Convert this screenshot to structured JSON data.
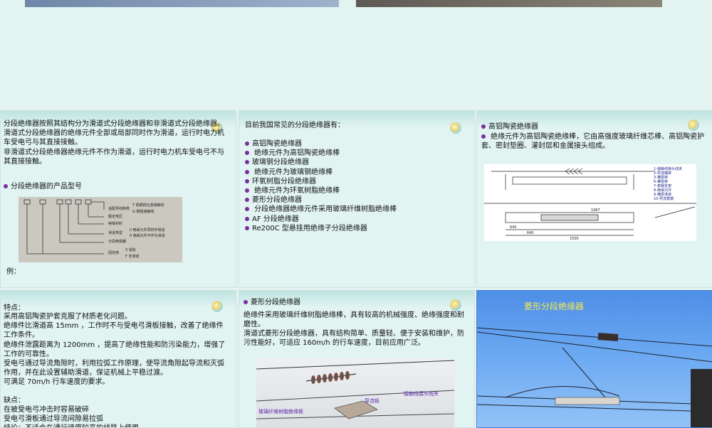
{
  "slide1": {
    "intro": "分段绝缘器按照其结构分为滑道式分段绝缘器和非滑道式分段绝缘器。\n滑道式分段绝缘器的绝缘元件全部或局部同时作为滑道，运行时电力机车受电弓与其直接接触。\n非滑道式分段绝缘器绝缘元件不作为滑道，运行时电力机车受电弓不与其直接接触。",
    "bullet": "分段绝缘器的产品型号",
    "example": "例："
  },
  "model_diagram": {
    "rows": [
      "适配导线种类",
      "额定电压",
      "绝缘材料",
      "滑道类型",
      "分段绝缘器",
      "固定用"
    ],
    "notes": [
      "T 铜或铜合金接触线",
      "G 钢铝接触线",
      "II 绝缘元件同时作滑道",
      "0 绝缘元件不作为滑道",
      "X 铝轨",
      "F 非滑道"
    ]
  },
  "slide2": {
    "title": "目前我国常见的分段绝缘器有：",
    "items": [
      "高铝陶瓷绝缘器",
      " 绝缘元件为高铝陶瓷绝缘棒",
      "玻璃钢分段绝缘器",
      " 绝缘元件为玻璃钢绝缘棒",
      "环氧树脂分段绝缘器",
      " 绝缘元件为环氧树脂绝缘棒",
      "菱形分段绝缘器",
      " 分段绝缘器绝缘元件采用玻璃纤维树脂绝缘棒",
      "AF 分段绝缘器",
      "Re200C 型悬挂用绝缘子分段绝缘器"
    ]
  },
  "slide3": {
    "title": "高铝陶瓷绝缘器",
    "desc": " 绝缘元件为高铝陶瓷绝缘棒，它由高强度玻璃纤维芯棒、高铝陶瓷护套、密封垫圈、灌封层和金属接头组成。",
    "legend": [
      "1-接触线接头线夹",
      "2-导流嘴架",
      "3-横梁架",
      "6-横梁架",
      "7-角钢支架",
      "8-绝缘元件",
      "9-横梁滑道",
      "10-导流角钢"
    ],
    "dims": [
      "640",
      "640",
      "1500",
      "1967"
    ]
  },
  "slide4": {
    "features_title": "特点：",
    "features": "采用高铝陶瓷护套克服了材质老化问题。\n绝缘件比滑道高 15mm ，工作时不与受电弓滑板接触，改善了绝缘件工作条件。\n绝缘件泄露距离为 1200mm ，提高了绝缘性能和防污染能力，增强了工作的可靠性。\n受电弓通过导流角隙时，利用拉弧工作原理，使导流角隙起导流和灭弧作用，并在此设置辅助滑道，保证机械上平稳过渡。\n可满足 70m/h 行车速度的要求。",
    "cons_title": "缺点：",
    "cons": "在被受电弓冲击时容易破碎\n受电弓滑板通过导流间隙易拉弧\n结论：不适合在通行速度较高的线路上使用"
  },
  "slide5": {
    "title": "菱形分段绝缘器",
    "p1": " 绝缘件采用玻璃纤维树脂绝缘棒，具有较高的机械强度、绝缘强度和耐磨性。",
    "p2": " 滑道式菱形分段绝缘器，具有结构简单、质量轻、便于安装和维护，防污性能好，可适应 160m/h 的行车速度，目前应用广泛。",
    "photo_labels": [
      "接触线接头线夹",
      "导流板",
      "玻璃纤维树脂绝缘板"
    ]
  },
  "slide6": {
    "title": "菱形分段绝缘器"
  }
}
